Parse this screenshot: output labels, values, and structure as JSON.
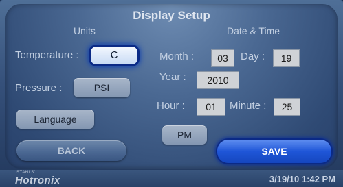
{
  "header": {
    "title": "Display Setup"
  },
  "units": {
    "heading": "Units",
    "temperature_label": "Temperature :",
    "temperature_value": "C",
    "pressure_label": "Pressure :",
    "pressure_value": "PSI",
    "language_label": "Language"
  },
  "datetime": {
    "heading": "Date & Time",
    "month_label": "Month :",
    "month_value": "03",
    "day_label": "Day :",
    "day_value": "19",
    "year_label": "Year :",
    "year_value": "2010",
    "hour_label": "Hour :",
    "hour_value": "01",
    "minute_label": "Minute :",
    "minute_value": "25",
    "ampm_value": "PM"
  },
  "actions": {
    "back_label": "BACK",
    "save_label": "SAVE"
  },
  "status": {
    "brand_small": "STAHLS'",
    "brand": "Hotronix",
    "datetime": "3/19/10  1:42 PM"
  },
  "colors": {
    "save_accent": "#1f56d8",
    "selected_glow": "#0f3fb0",
    "background": "#35507a"
  }
}
